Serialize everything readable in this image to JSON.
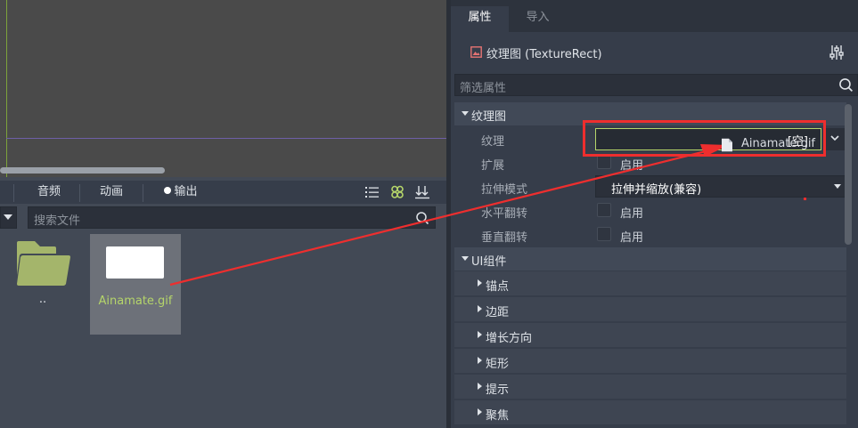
{
  "bottom_panel": {
    "tabs": [
      {
        "label": "音频"
      },
      {
        "label": "动画"
      },
      {
        "label": "输出"
      }
    ],
    "search_placeholder": "搜索文件",
    "files": [
      {
        "name": "..",
        "icon": "folder-icon"
      },
      {
        "name": "Ainamate.gif",
        "icon": "image-thumbnail"
      }
    ]
  },
  "inspector": {
    "tabs": [
      {
        "label": "属性",
        "active": true
      },
      {
        "label": "导入",
        "active": false
      }
    ],
    "node_title": "纹理图 (TextureRect)",
    "filter_placeholder": "筛选属性",
    "sections": [
      {
        "label": "纹理图",
        "properties": [
          {
            "label": "纹理",
            "value": "[空]"
          },
          {
            "label": "扩展",
            "check_label": "启用"
          },
          {
            "label": "拉伸模式",
            "value": "拉伸并缩放(兼容)"
          },
          {
            "label": "水平翻转",
            "check_label": "启用"
          },
          {
            "label": "垂直翻转",
            "check_label": "启用"
          }
        ]
      },
      {
        "label": "UI组件",
        "subsections": [
          "锚点",
          "边距",
          "增长方向",
          "矩形",
          "提示",
          "聚焦"
        ]
      }
    ]
  },
  "drag": {
    "file_name": "Ainamate.gif"
  },
  "colors": {
    "accent_green": "#b5d56a",
    "annotation_red": "#ee2e2e",
    "panel_bg": "#363d4a"
  }
}
